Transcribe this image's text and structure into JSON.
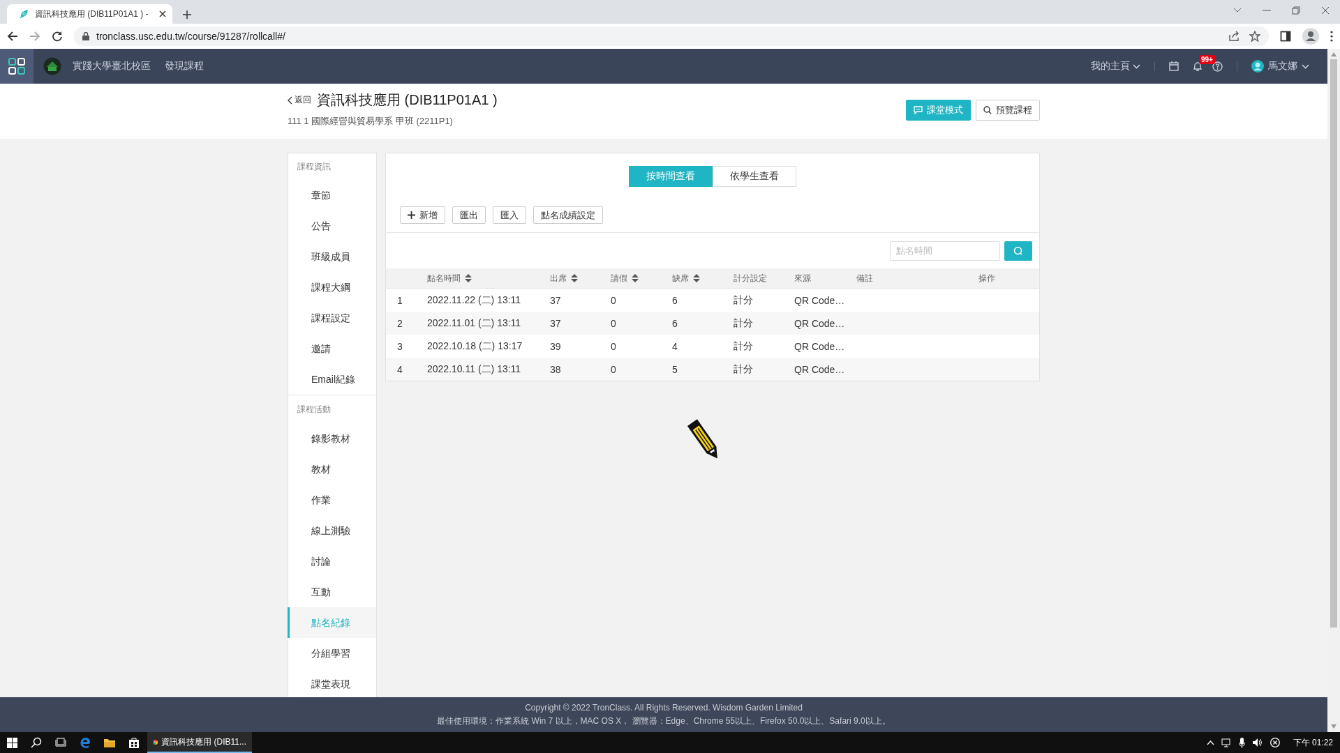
{
  "browser": {
    "tab_title": "資訊科技應用 (DIB11P01A1 ) -",
    "url": "tronclass.usc.edu.tw/course/91287/rollcall#/"
  },
  "nav": {
    "links": [
      "實踐大學臺北校區",
      "發現課程"
    ],
    "home": "我的主頁",
    "badge": "99+",
    "user": "馬文娜"
  },
  "course": {
    "back": "返回",
    "title": "資訊科技應用 (DIB11P01A1 )",
    "subtitle": "111 1 國際經營與貿易學系 甲班 (2211P1)",
    "buttons": [
      {
        "label": "課堂模式",
        "kind": "primary"
      },
      {
        "label": "預覽課程",
        "kind": "search"
      }
    ]
  },
  "sidebar": [
    {
      "heading": "課程資訊",
      "items": [
        {
          "label": "章節",
          "selected": false
        },
        {
          "label": "公告",
          "selected": false
        },
        {
          "label": "班級成員",
          "selected": false
        },
        {
          "label": "課程大綱",
          "selected": false
        },
        {
          "label": "課程設定",
          "selected": false
        },
        {
          "label": "邀請",
          "selected": false
        },
        {
          "label": "Email紀錄",
          "selected": false
        }
      ]
    },
    {
      "heading": "課程活動",
      "items": [
        {
          "label": "錄影教材",
          "selected": false
        },
        {
          "label": "教材",
          "selected": false
        },
        {
          "label": "作業",
          "selected": false
        },
        {
          "label": "線上測驗",
          "selected": false
        },
        {
          "label": "討論",
          "selected": false
        },
        {
          "label": "互動",
          "selected": false
        },
        {
          "label": "點名紀錄",
          "selected": true
        },
        {
          "label": "分組學習",
          "selected": false
        },
        {
          "label": "課堂表現",
          "selected": false
        }
      ]
    }
  ],
  "view_toggle": [
    {
      "label": "按時間查看",
      "selected": true
    },
    {
      "label": "依學生查看",
      "selected": false
    }
  ],
  "toolbar": [
    {
      "label": "新增",
      "kind": "add"
    },
    {
      "label": "匯出",
      "kind": "plain"
    },
    {
      "label": "匯入",
      "kind": "plain"
    },
    {
      "label": "點名成績設定",
      "kind": "plain"
    }
  ],
  "search": {
    "placeholder": "點名時間"
  },
  "table": {
    "columns": [
      {
        "label": "點名時間",
        "sortable": true
      },
      {
        "label": "出席",
        "sortable": true
      },
      {
        "label": "請假",
        "sortable": true
      },
      {
        "label": "缺席",
        "sortable": true
      },
      {
        "label": "計分設定",
        "sortable": false
      },
      {
        "label": "來源",
        "sortable": false
      },
      {
        "label": "備註",
        "sortable": false
      },
      {
        "label": "操作",
        "sortable": false
      }
    ],
    "rows": [
      {
        "number": "1",
        "cells": [
          "2022.11.22 (二) 13:11",
          "37",
          "0",
          "6",
          "計分",
          "QR Code…"
        ]
      },
      {
        "number": "2",
        "cells": [
          "2022.11.01 (二) 13:11",
          "37",
          "0",
          "6",
          "計分",
          "QR Code…"
        ]
      },
      {
        "number": "3",
        "cells": [
          "2022.10.18 (二) 13:17",
          "39",
          "0",
          "4",
          "計分",
          "QR Code…"
        ]
      },
      {
        "number": "4",
        "cells": [
          "2022.10.11 (二) 13:11",
          "38",
          "0",
          "5",
          "計分",
          "QR Code…"
        ]
      }
    ]
  },
  "footer": [
    "Copyright © 2022 TronClass. All Rights Reserved. Wisdom Garden Limited",
    "最佳使用環境：作業系統 Win 7 以上，MAC OS X， 瀏覽器：Edge、Chrome 55以上、Firefox 50.0以上、Safari 9.0以上。"
  ],
  "taskbar": {
    "app": "資訊科技應用 (DIB11...",
    "clock": "下午 01:22"
  }
}
